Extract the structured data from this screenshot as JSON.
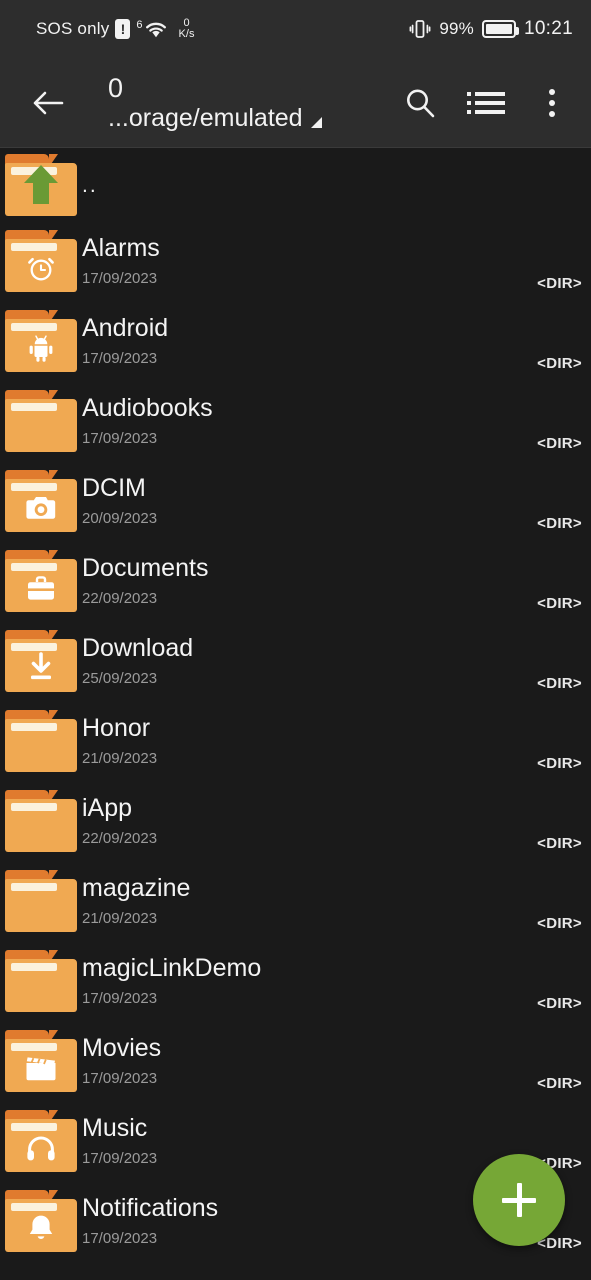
{
  "status_bar": {
    "carrier": "SOS only",
    "alert_icon": "!",
    "wifi_sup": "6",
    "wifi_icon": "wifi-icon",
    "net_speed_value": "0",
    "net_speed_unit": "K/s",
    "vibrate_icon": "vibrate-icon",
    "battery_percent": "99%",
    "battery_level": 99,
    "clock": "10:21"
  },
  "toolbar": {
    "back_icon": "arrow-left-icon",
    "count": "0",
    "path": "...orage/emulated",
    "caret_icon": "dropdown-caret-icon",
    "search_icon": "search-icon",
    "view_icon": "list-view-icon",
    "overflow_icon": "overflow-menu-icon"
  },
  "colors": {
    "status_bar_bg": "#2d2d2d",
    "toolbar_bg": "#2d2d2d",
    "list_bg": "#1a1a1a",
    "folder_body": "#f0a952",
    "folder_tab": "#e07b2e",
    "folder_stripe": "#fbf2dd",
    "up_arrow_green": "#6a9a35",
    "fab_green": "#76a736",
    "primary_text": "#f4f4f4",
    "secondary_text": "#9b9b9b"
  },
  "file_list": [
    {
      "name": "..",
      "date": "",
      "size": "",
      "icon": "folder-up-icon"
    },
    {
      "name": "Alarms",
      "date": "17/09/2023",
      "size": "<DIR>",
      "icon": "folder-alarm-icon"
    },
    {
      "name": "Android",
      "date": "17/09/2023",
      "size": "<DIR>",
      "icon": "folder-android-icon"
    },
    {
      "name": "Audiobooks",
      "date": "17/09/2023",
      "size": "<DIR>",
      "icon": "folder-plain-icon"
    },
    {
      "name": "DCIM",
      "date": "20/09/2023",
      "size": "<DIR>",
      "icon": "folder-camera-icon"
    },
    {
      "name": "Documents",
      "date": "22/09/2023",
      "size": "<DIR>",
      "icon": "folder-briefcase-icon"
    },
    {
      "name": "Download",
      "date": "25/09/2023",
      "size": "<DIR>",
      "icon": "folder-download-icon"
    },
    {
      "name": "Honor",
      "date": "21/09/2023",
      "size": "<DIR>",
      "icon": "folder-plain-icon"
    },
    {
      "name": "iApp",
      "date": "22/09/2023",
      "size": "<DIR>",
      "icon": "folder-plain-icon"
    },
    {
      "name": "magazine",
      "date": "21/09/2023",
      "size": "<DIR>",
      "icon": "folder-plain-icon"
    },
    {
      "name": "magicLinkDemo",
      "date": "17/09/2023",
      "size": "<DIR>",
      "icon": "folder-plain-icon"
    },
    {
      "name": "Movies",
      "date": "17/09/2023",
      "size": "<DIR>",
      "icon": "folder-movie-icon"
    },
    {
      "name": "Music",
      "date": "17/09/2023",
      "size": "<DIR>",
      "icon": "folder-music-icon"
    },
    {
      "name": "Notifications",
      "date": "17/09/2023",
      "size": "<DIR>",
      "icon": "folder-bell-icon"
    }
  ],
  "fab": {
    "icon": "plus-icon",
    "label": "+"
  }
}
